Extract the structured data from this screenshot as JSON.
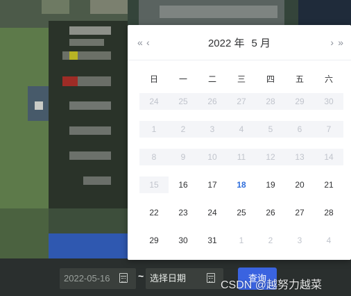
{
  "calendar": {
    "year": "2022 年",
    "month": "5 月",
    "nav": {
      "prev_year": "«",
      "prev_month": "‹",
      "next_month": "›",
      "next_year": "»"
    },
    "weekdays": [
      "日",
      "一",
      "二",
      "三",
      "四",
      "五",
      "六"
    ],
    "weeks": [
      [
        {
          "d": "24",
          "s": "dis"
        },
        {
          "d": "25",
          "s": "dis"
        },
        {
          "d": "26",
          "s": "dis"
        },
        {
          "d": "27",
          "s": "dis"
        },
        {
          "d": "28",
          "s": "dis"
        },
        {
          "d": "29",
          "s": "dis"
        },
        {
          "d": "30",
          "s": "dis"
        }
      ],
      [
        {
          "d": "1",
          "s": "dis"
        },
        {
          "d": "2",
          "s": "dis"
        },
        {
          "d": "3",
          "s": "dis"
        },
        {
          "d": "4",
          "s": "dis"
        },
        {
          "d": "5",
          "s": "dis"
        },
        {
          "d": "6",
          "s": "dis"
        },
        {
          "d": "7",
          "s": "dis"
        }
      ],
      [
        {
          "d": "8",
          "s": "dis"
        },
        {
          "d": "9",
          "s": "dis"
        },
        {
          "d": "10",
          "s": "dis"
        },
        {
          "d": "11",
          "s": "dis"
        },
        {
          "d": "12",
          "s": "dis"
        },
        {
          "d": "13",
          "s": "dis"
        },
        {
          "d": "14",
          "s": "dis"
        }
      ],
      [
        {
          "d": "15",
          "s": "dis"
        },
        {
          "d": "16",
          "s": "on"
        },
        {
          "d": "17",
          "s": "on"
        },
        {
          "d": "18",
          "s": "today"
        },
        {
          "d": "19",
          "s": "on"
        },
        {
          "d": "20",
          "s": "on"
        },
        {
          "d": "21",
          "s": "on"
        }
      ],
      [
        {
          "d": "22",
          "s": "on"
        },
        {
          "d": "23",
          "s": "on"
        },
        {
          "d": "24",
          "s": "on"
        },
        {
          "d": "25",
          "s": "on"
        },
        {
          "d": "26",
          "s": "on"
        },
        {
          "d": "27",
          "s": "on"
        },
        {
          "d": "28",
          "s": "on"
        }
      ],
      [
        {
          "d": "29",
          "s": "on"
        },
        {
          "d": "30",
          "s": "on"
        },
        {
          "d": "31",
          "s": "on"
        },
        {
          "d": "1",
          "s": "muted"
        },
        {
          "d": "2",
          "s": "muted"
        },
        {
          "d": "3",
          "s": "muted"
        },
        {
          "d": "4",
          "s": "muted"
        }
      ]
    ]
  },
  "form": {
    "start_date": "2022-05-16",
    "separator": "~",
    "end_placeholder": "选择日期",
    "query_label": "查询"
  },
  "watermark": "CSDN @越努力越菜",
  "colors": {
    "accent": "#3a63e0",
    "today": "#2d6ddb"
  }
}
